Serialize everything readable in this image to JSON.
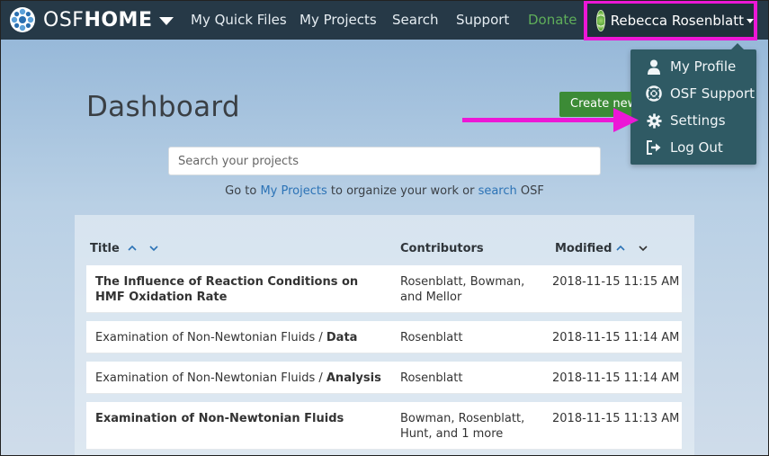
{
  "navbar": {
    "brand_light": "OSF",
    "brand_bold": "HOME",
    "links": [
      {
        "label": "My Quick Files"
      },
      {
        "label": "My Projects"
      },
      {
        "label": "Search"
      },
      {
        "label": "Support"
      },
      {
        "label": "Donate"
      }
    ],
    "user_name": "Rebecca Rosenblatt"
  },
  "user_menu": {
    "items": [
      {
        "label": "My Profile",
        "icon": "user-icon"
      },
      {
        "label": "OSF Support",
        "icon": "lifebuoy-icon"
      },
      {
        "label": "Settings",
        "icon": "gear-icon"
      },
      {
        "label": "Log Out",
        "icon": "sign-out-icon"
      }
    ]
  },
  "dashboard": {
    "title": "Dashboard",
    "create_button": "Create new project",
    "search_placeholder": "Search your projects",
    "goto_prefix": "Go to ",
    "goto_link1": "My Projects",
    "goto_middle": " to organize your work or ",
    "goto_link2": "search",
    "goto_suffix": " OSF"
  },
  "table": {
    "headers": {
      "title": "Title",
      "contributors": "Contributors",
      "modified": "Modified"
    },
    "rows": [
      {
        "title_prefix": "",
        "title_bold": "The Influence of Reaction Conditions on HMF Oxidation Rate",
        "contributors": "Rosenblatt, Bowman, and Mellor",
        "modified": "2018-11-15 11:15 AM"
      },
      {
        "title_prefix": "Examination of Non-Newtonian Fluids / ",
        "title_bold": "Data",
        "contributors": "Rosenblatt",
        "modified": "2018-11-15 11:14 AM"
      },
      {
        "title_prefix": "Examination of Non-Newtonian Fluids / ",
        "title_bold": "Analysis",
        "contributors": "Rosenblatt",
        "modified": "2018-11-15 11:14 AM"
      },
      {
        "title_prefix": "",
        "title_bold": "Examination of Non-Newtonian Fluids",
        "contributors": "Bowman, Rosenblatt, Hunt, and 1 more",
        "modified": "2018-11-15 11:13 AM"
      }
    ]
  },
  "colors": {
    "navbar": "#263947",
    "highlight": "#ec17d6",
    "dropdown": "#2f5a64",
    "create": "#3c8b36",
    "link": "#2c73b6",
    "donate": "#5fae5a"
  }
}
